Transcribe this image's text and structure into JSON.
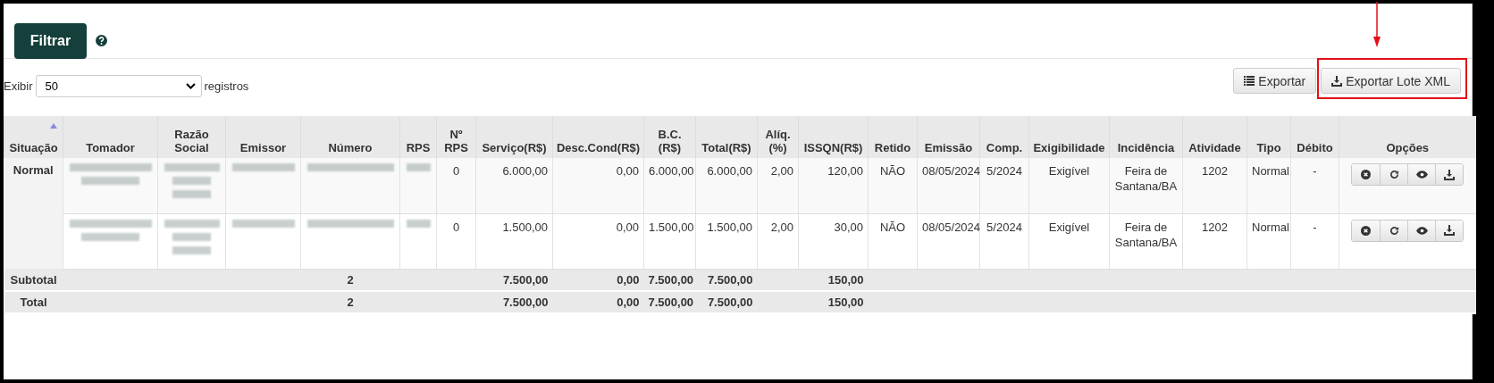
{
  "filter_button": {
    "label": "Filtrar"
  },
  "page_length": {
    "before": "Exibir",
    "value": "50",
    "after": "registros"
  },
  "export_buttons": [
    {
      "label": "Exportar",
      "kind": "list",
      "highlighted": false
    },
    {
      "label": "Exportar Lote XML",
      "kind": "download",
      "highlighted": true
    }
  ],
  "table": {
    "columns": [
      {
        "label": "Situação",
        "kind": "text",
        "sorted": true
      },
      {
        "label": "Tomador",
        "kind": "text",
        "sorted": false
      },
      {
        "label": "Razão Social",
        "kind": "text",
        "sorted": false
      },
      {
        "label": "Emissor",
        "kind": "text",
        "sorted": false
      },
      {
        "label": "Número",
        "kind": "text",
        "sorted": false
      },
      {
        "label": "RPS",
        "kind": "text",
        "sorted": false
      },
      {
        "label": "Nº RPS",
        "kind": "text",
        "sorted": false
      },
      {
        "label": "Serviço(R$)",
        "kind": "money",
        "sorted": false
      },
      {
        "label": "Desc.Cond(R$)",
        "kind": "money",
        "sorted": false
      },
      {
        "label": "B.C. (R$)",
        "kind": "money",
        "sorted": false
      },
      {
        "label": "Total(R$)",
        "kind": "money",
        "sorted": false
      },
      {
        "label": "Alíq. (%)",
        "kind": "money",
        "sorted": false
      },
      {
        "label": "ISSQN(R$)",
        "kind": "money",
        "sorted": false
      },
      {
        "label": "Retido",
        "kind": "text",
        "sorted": false
      },
      {
        "label": "Emissão",
        "kind": "text",
        "sorted": false
      },
      {
        "label": "Comp.",
        "kind": "text",
        "sorted": false
      },
      {
        "label": "Exigibilidade",
        "kind": "text",
        "sorted": false
      },
      {
        "label": "Incidência",
        "kind": "text",
        "sorted": false
      },
      {
        "label": "Atividade",
        "kind": "text",
        "sorted": false
      },
      {
        "label": "Tipo",
        "kind": "text",
        "sorted": false
      },
      {
        "label": "Débito",
        "kind": "text",
        "sorted": false
      },
      {
        "label": "Opções",
        "kind": "actions",
        "sorted": false
      }
    ],
    "groups": [
      {
        "label": "Normal",
        "rows": [
          {
            "cells": [
              {
                "kind": "blurred"
              },
              {
                "kind": "blurred"
              },
              {
                "kind": "blurred"
              },
              {
                "kind": "blurred"
              },
              {
                "kind": "blurred"
              },
              {
                "kind": "text",
                "text": "0"
              },
              {
                "kind": "text",
                "text": "6.000,00"
              },
              {
                "kind": "text",
                "text": "0,00"
              },
              {
                "kind": "text",
                "text": "6.000,00"
              },
              {
                "kind": "text",
                "text": "6.000,00"
              },
              {
                "kind": "text",
                "text": "2,00"
              },
              {
                "kind": "text",
                "text": "120,00"
              },
              {
                "kind": "text",
                "text": "NÃO"
              },
              {
                "kind": "text",
                "text": "08/05/2024"
              },
              {
                "kind": "text",
                "text": "5/2024"
              },
              {
                "kind": "text",
                "text": "Exigível"
              },
              {
                "kind": "text",
                "text": "Feira de Santana/BA"
              },
              {
                "kind": "text",
                "text": "1202"
              },
              {
                "kind": "text",
                "text": "Normal"
              },
              {
                "kind": "text",
                "text": "-"
              },
              {
                "kind": "actions"
              }
            ]
          },
          {
            "cells": [
              {
                "kind": "blurred"
              },
              {
                "kind": "blurred"
              },
              {
                "kind": "blurred"
              },
              {
                "kind": "blurred"
              },
              {
                "kind": "blurred"
              },
              {
                "kind": "text",
                "text": "0"
              },
              {
                "kind": "text",
                "text": "1.500,00"
              },
              {
                "kind": "text",
                "text": "0,00"
              },
              {
                "kind": "text",
                "text": "1.500,00"
              },
              {
                "kind": "text",
                "text": "1.500,00"
              },
              {
                "kind": "text",
                "text": "2,00"
              },
              {
                "kind": "text",
                "text": "30,00"
              },
              {
                "kind": "text",
                "text": "NÃO"
              },
              {
                "kind": "text",
                "text": "08/05/2024"
              },
              {
                "kind": "text",
                "text": "5/2024"
              },
              {
                "kind": "text",
                "text": "Exigível"
              },
              {
                "kind": "text",
                "text": "Feira de Santana/BA"
              },
              {
                "kind": "text",
                "text": "1202"
              },
              {
                "kind": "text",
                "text": "Normal"
              },
              {
                "kind": "text",
                "text": "-"
              },
              {
                "kind": "actions"
              }
            ]
          }
        ]
      }
    ],
    "summaries": [
      {
        "cells": [
          {
            "kind": "label",
            "text": "Subtotal"
          },
          {
            "kind": "empty"
          },
          {
            "kind": "empty"
          },
          {
            "kind": "empty"
          },
          {
            "kind": "value",
            "text": "2"
          },
          {
            "kind": "empty"
          },
          {
            "kind": "empty"
          },
          {
            "kind": "value",
            "text": "7.500,00"
          },
          {
            "kind": "value",
            "text": "0,00"
          },
          {
            "kind": "value",
            "text": "7.500,00"
          },
          {
            "kind": "value",
            "text": "7.500,00"
          },
          {
            "kind": "empty"
          },
          {
            "kind": "value",
            "text": "150,00"
          },
          {
            "kind": "empty"
          },
          {
            "kind": "empty"
          },
          {
            "kind": "empty"
          },
          {
            "kind": "empty"
          },
          {
            "kind": "empty"
          },
          {
            "kind": "empty"
          },
          {
            "kind": "empty"
          },
          {
            "kind": "empty"
          },
          {
            "kind": "empty"
          }
        ]
      },
      {
        "cells": [
          {
            "kind": "label",
            "text": "Total"
          },
          {
            "kind": "empty"
          },
          {
            "kind": "empty"
          },
          {
            "kind": "empty"
          },
          {
            "kind": "value",
            "text": "2"
          },
          {
            "kind": "empty"
          },
          {
            "kind": "empty"
          },
          {
            "kind": "value",
            "text": "7.500,00"
          },
          {
            "kind": "value",
            "text": "0,00"
          },
          {
            "kind": "value",
            "text": "7.500,00"
          },
          {
            "kind": "value",
            "text": "7.500,00"
          },
          {
            "kind": "empty"
          },
          {
            "kind": "value",
            "text": "150,00"
          },
          {
            "kind": "empty"
          },
          {
            "kind": "empty"
          },
          {
            "kind": "empty"
          },
          {
            "kind": "empty"
          },
          {
            "kind": "empty"
          },
          {
            "kind": "empty"
          },
          {
            "kind": "empty"
          },
          {
            "kind": "empty"
          },
          {
            "kind": "empty"
          }
        ]
      }
    ]
  }
}
